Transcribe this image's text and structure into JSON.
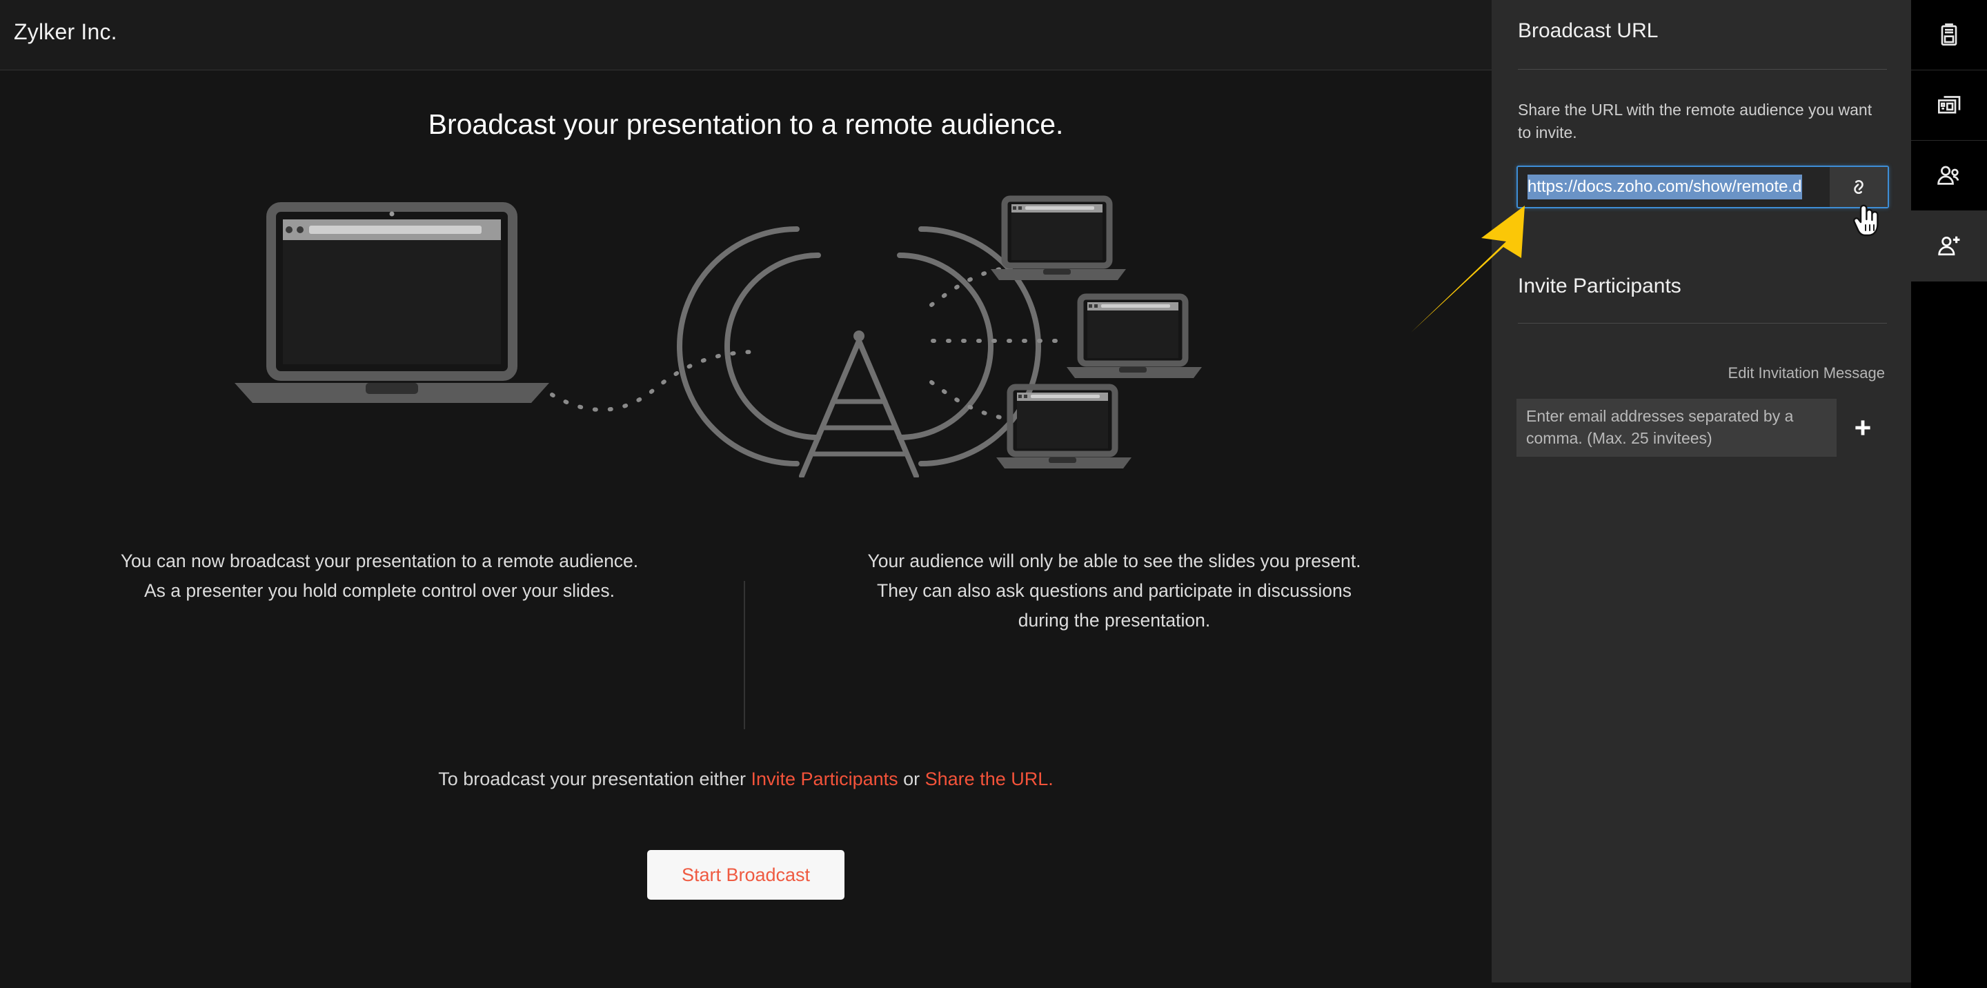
{
  "topbar": {
    "title": "Zylker Inc."
  },
  "stage": {
    "headline": "Broadcast your presentation to a remote audience.",
    "columns": [
      {
        "line1": "You can now broadcast your presentation to a remote audience.",
        "line2": "As a presenter you hold complete control over your slides."
      },
      {
        "line1": "Your audience will only be able to see the slides you present.",
        "line2": "They can also ask questions and participate in discussions",
        "line3": "during the presentation."
      }
    ],
    "cta": {
      "prefix": "To broadcast your presentation either ",
      "link1": "Invite Participants",
      "middle": " or ",
      "link2": "Share the URL.",
      "link_color": "#f4533a"
    },
    "start_button": "Start Broadcast"
  },
  "panel": {
    "broadcast_url": {
      "title": "Broadcast URL",
      "description": "Share the URL with the remote audience you want to invite.",
      "url_value": "https://docs.zoho.com/show/remote.d",
      "url_selected": true,
      "selection_color": "#6a93c6",
      "focus_border_color": "#3e8ed6",
      "copy_icon": "link-chain-icon"
    },
    "invite_participants": {
      "title": "Invite Participants",
      "edit_link": "Edit Invitation Message",
      "email_placeholder": "Enter email addresses separated by a comma. (Max. 25 invitees)",
      "email_value": "",
      "add_icon": "plus-icon"
    }
  },
  "rail": {
    "items": [
      {
        "name": "notes-panel",
        "icon": "notes-icon",
        "active": false
      },
      {
        "name": "slides-panel",
        "icon": "slides-layout-icon",
        "active": false
      },
      {
        "name": "audience-panel",
        "icon": "people-icon",
        "active": false
      },
      {
        "name": "invite-panel",
        "icon": "add-person-icon",
        "active": true
      }
    ]
  },
  "annotation": {
    "arrow_color": "#fbc707",
    "points_to": "broadcast-url-copy-button"
  },
  "cursor": {
    "type": "pointing-hand-cursor"
  }
}
